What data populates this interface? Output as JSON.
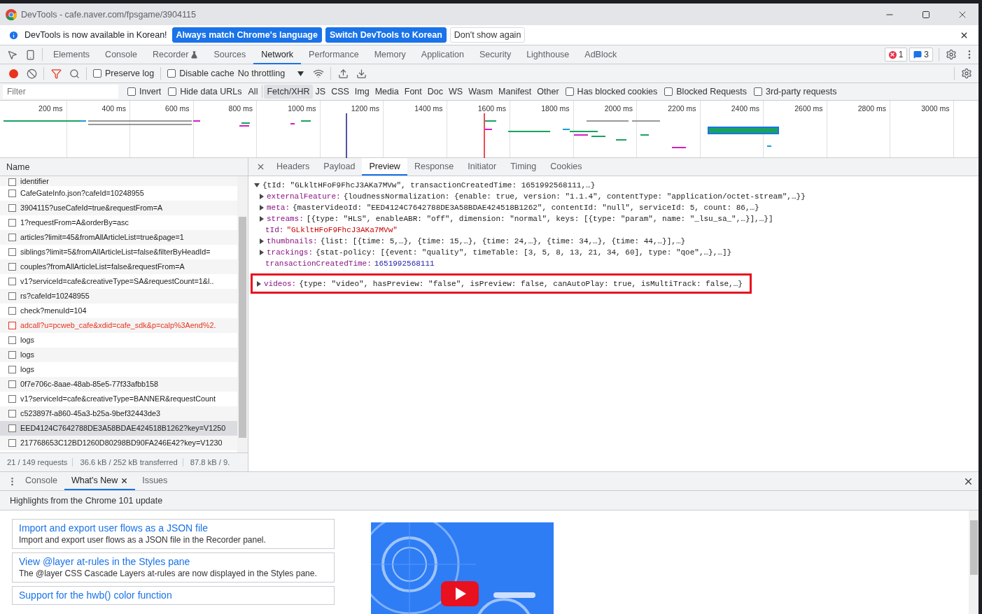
{
  "window": {
    "title": "DevTools - cafe.naver.com/fpsgame/3904115"
  },
  "infobar": {
    "message": "DevTools is now available in Korean!",
    "buttons": [
      {
        "label": "Always match Chrome's language",
        "primary": true
      },
      {
        "label": "Switch DevTools to Korean",
        "primary": true
      },
      {
        "label": "Don't show again",
        "primary": false
      }
    ]
  },
  "panel_tabs": [
    {
      "label": "Elements",
      "selected": false,
      "experimental": false
    },
    {
      "label": "Console",
      "selected": false,
      "experimental": false
    },
    {
      "label": "Recorder",
      "selected": false,
      "experimental": true
    },
    {
      "label": "Sources",
      "selected": false,
      "experimental": false
    },
    {
      "label": "Network",
      "selected": true,
      "experimental": false
    },
    {
      "label": "Performance",
      "selected": false,
      "experimental": false
    },
    {
      "label": "Memory",
      "selected": false,
      "experimental": false
    },
    {
      "label": "Application",
      "selected": false,
      "experimental": false
    },
    {
      "label": "Security",
      "selected": false,
      "experimental": false
    },
    {
      "label": "Lighthouse",
      "selected": false,
      "experimental": false
    },
    {
      "label": "AdBlock",
      "selected": false,
      "experimental": false
    }
  ],
  "issues": {
    "errors": "1",
    "messages": "3"
  },
  "network_toolbar": {
    "recording": true,
    "filter_active": true,
    "preserve_log": {
      "label": "Preserve log",
      "checked": false
    },
    "disable_cache": {
      "label": "Disable cache",
      "checked": false
    },
    "throttling": "No throttling"
  },
  "filter_bar": {
    "placeholder": "Filter",
    "options": [
      {
        "label": "Invert",
        "checked": false
      },
      {
        "label": "Hide data URLs",
        "checked": false
      }
    ],
    "types": [
      {
        "label": "All",
        "selected": false
      },
      {
        "label": "Fetch/XHR",
        "selected": true
      },
      {
        "label": "JS",
        "selected": false
      },
      {
        "label": "CSS",
        "selected": false
      },
      {
        "label": "Img",
        "selected": false
      },
      {
        "label": "Media",
        "selected": false
      },
      {
        "label": "Font",
        "selected": false
      },
      {
        "label": "Doc",
        "selected": false
      },
      {
        "label": "WS",
        "selected": false
      },
      {
        "label": "Wasm",
        "selected": false
      },
      {
        "label": "Manifest",
        "selected": false
      },
      {
        "label": "Other",
        "selected": false
      }
    ],
    "extra_options": [
      {
        "label": "Has blocked cookies",
        "checked": false
      },
      {
        "label": "Blocked Requests",
        "checked": false
      },
      {
        "label": "3rd-party requests",
        "checked": false
      }
    ]
  },
  "timeline": {
    "ticks": [
      "200 ms",
      "400 ms",
      "600 ms",
      "800 ms",
      "1000 ms",
      "1200 ms",
      "1400 ms",
      "1600 ms",
      "1800 ms",
      "2000 ms",
      "2200 ms",
      "2400 ms",
      "2600 ms",
      "2800 ms",
      "3000 ms"
    ]
  },
  "requests": {
    "header": "Name",
    "rows": [
      {
        "name": "identifier",
        "failed": false,
        "selected": false,
        "checked": false
      },
      {
        "name": "CafeGateInfo.json?cafeId=10248955",
        "failed": false,
        "selected": false,
        "checked": false
      },
      {
        "name": "3904115?useCafeId=true&requestFrom=A",
        "failed": false,
        "selected": false,
        "checked": false
      },
      {
        "name": "1?requestFrom=A&orderBy=asc",
        "failed": false,
        "selected": false,
        "checked": false
      },
      {
        "name": "articles?limit=45&fromAllArticleList=true&page=1",
        "failed": false,
        "selected": false,
        "checked": false
      },
      {
        "name": "siblings?limit=5&fromAllArticleList=false&filterByHeadId=",
        "failed": false,
        "selected": false,
        "checked": false
      },
      {
        "name": "couples?fromAllArticleList=false&requestFrom=A",
        "failed": false,
        "selected": false,
        "checked": false
      },
      {
        "name": "v1?serviceId=cafe&creativeType=SA&requestCount=1&l..",
        "failed": false,
        "selected": false,
        "checked": false
      },
      {
        "name": "rs?cafeId=10248955",
        "failed": false,
        "selected": false,
        "checked": false
      },
      {
        "name": "check?menuId=104",
        "failed": false,
        "selected": false,
        "checked": false
      },
      {
        "name": "adcall?u=pcweb_cafe&xdid=cafe_sdk&p=calp%3Aend%2.",
        "failed": true,
        "selected": false,
        "checked": false
      },
      {
        "name": "logs",
        "failed": false,
        "selected": false,
        "checked": false
      },
      {
        "name": "logs",
        "failed": false,
        "selected": false,
        "checked": false
      },
      {
        "name": "logs",
        "failed": false,
        "selected": false,
        "checked": false
      },
      {
        "name": "0f7e706c-8aae-48ab-85e5-77f33afbb158",
        "failed": false,
        "selected": false,
        "checked": false
      },
      {
        "name": "v1?serviceId=cafe&creativeType=BANNER&requestCount",
        "failed": false,
        "selected": false,
        "checked": false
      },
      {
        "name": "c523897f-a860-45a3-b25a-9bef32443de3",
        "failed": false,
        "selected": false,
        "checked": false
      },
      {
        "name": "EED4124C7642788DE3A58BDAE424518B1262?key=V1250",
        "failed": false,
        "selected": true,
        "checked": false
      },
      {
        "name": "217768653C12BD1260D80298BD90FA246E42?key=V1230",
        "failed": false,
        "selected": false,
        "checked": false
      }
    ]
  },
  "status_bar": [
    "21 / 149 requests",
    "36.6 kB / 252 kB transferred",
    "87.8 kB / 9."
  ],
  "detail_tabs": [
    {
      "label": "Headers",
      "selected": false
    },
    {
      "label": "Payload",
      "selected": false
    },
    {
      "label": "Preview",
      "selected": true
    },
    {
      "label": "Response",
      "selected": false
    },
    {
      "label": "Initiator",
      "selected": false
    },
    {
      "label": "Timing",
      "selected": false
    },
    {
      "label": "Cookies",
      "selected": false
    }
  ],
  "preview": {
    "lines": [
      {
        "kind": "root",
        "expanded": true,
        "highlighted": false,
        "text": "{tId: \"GLkltHFoF9FhcJ3AKa7MVw\", transactionCreatedTime: 1651992568111,…}"
      },
      {
        "kind": "node",
        "expanded": false,
        "highlighted": false,
        "key": "externalFeature:",
        "value": "{loudnessNormalization: {enable: true, version: \"1.1.4\", contentType: \"application/octet-stream\",…}}"
      },
      {
        "kind": "node",
        "expanded": false,
        "highlighted": false,
        "key": "meta:",
        "value": "{masterVideoId: \"EED4124C7642788DE3A58BDAE424518B1262\", contentId: \"null\", serviceId: 5, count: 86,…}"
      },
      {
        "kind": "node",
        "expanded": false,
        "highlighted": false,
        "key": "streams:",
        "value": "[{type: \"HLS\", enableABR: \"off\", dimension: \"normal\", keys: [{type: \"param\", name: \"_lsu_sa_\",…}],…}]"
      },
      {
        "kind": "string_leaf",
        "highlighted": false,
        "key": "tId:",
        "value": "\"GLkltHFoF9FhcJ3AKa7MVw\""
      },
      {
        "kind": "node",
        "expanded": false,
        "highlighted": false,
        "key": "thumbnails:",
        "value": "{list: [{time: 5,…}, {time: 15,…}, {time: 24,…}, {time: 34,…}, {time: 44,…}],…}"
      },
      {
        "kind": "node",
        "expanded": false,
        "highlighted": false,
        "key": "trackings:",
        "value": "{stat-policy: [{event: \"quality\", timeTable: [3, 5, 8, 13, 21, 34, 60], type: \"qoe\",…},…]}"
      },
      {
        "kind": "number_leaf",
        "highlighted": false,
        "key": "transactionCreatedTime:",
        "value": "1651992568111"
      },
      {
        "kind": "node",
        "expanded": false,
        "highlighted": true,
        "key": "videos:",
        "value": "{type: \"video\", hasPreview: \"false\", isPreview: false, canAutoPlay: true, isMultiTrack: false,…}"
      }
    ]
  },
  "drawer": {
    "tabs": [
      {
        "label": "Console",
        "selected": false,
        "closable": false
      },
      {
        "label": "What's New",
        "selected": true,
        "closable": true
      },
      {
        "label": "Issues",
        "selected": false,
        "closable": false
      }
    ],
    "heading": "Highlights from the Chrome 101 update",
    "cards": [
      {
        "title": "Import and export user flows as a JSON file",
        "description": "Import and export user flows as a JSON file in the Recorder panel."
      },
      {
        "title": "View @layer at-rules in the Styles pane",
        "description": "The @layer CSS Cascade Layers at-rules are now displayed in the Styles pane."
      },
      {
        "title": "Support for the hwb() color function"
      }
    ]
  }
}
